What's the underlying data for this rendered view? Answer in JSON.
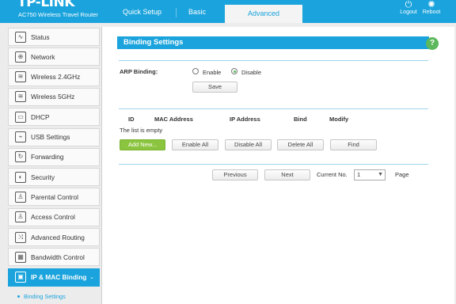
{
  "header": {
    "logo": "TP-LINK",
    "model": "AC750 Wireless Travel Router",
    "tabs": [
      {
        "label": "Quick Setup"
      },
      {
        "label": "Basic"
      },
      {
        "label": "Advanced"
      }
    ],
    "logout_label": "Logout",
    "reboot_label": "Reboot"
  },
  "sidebar": {
    "items": [
      {
        "label": "Status",
        "icon": "status-icon",
        "glyph": "∿"
      },
      {
        "label": "Network",
        "icon": "network-icon",
        "glyph": "⊕"
      },
      {
        "label": "Wireless 2.4GHz",
        "icon": "wireless-icon",
        "glyph": "≋"
      },
      {
        "label": "Wireless 5GHz",
        "icon": "wireless-icon",
        "glyph": "≋"
      },
      {
        "label": "DHCP",
        "icon": "dhcp-icon",
        "glyph": "▭"
      },
      {
        "label": "USB Settings",
        "icon": "usb-icon",
        "glyph": "⌁"
      },
      {
        "label": "Forwarding",
        "icon": "forwarding-icon",
        "glyph": "↻"
      },
      {
        "label": "Security",
        "icon": "security-icon",
        "glyph": "◐"
      },
      {
        "label": "Parental Control",
        "icon": "parental-control-icon",
        "glyph": "♙"
      },
      {
        "label": "Access Control",
        "icon": "access-control-icon",
        "glyph": "♙"
      },
      {
        "label": "Advanced Routing",
        "icon": "routing-icon",
        "glyph": "⤨"
      },
      {
        "label": "Bandwidth Control",
        "icon": "bandwidth-icon",
        "glyph": "▦"
      },
      {
        "label": "IP & MAC Binding",
        "icon": "binding-icon",
        "glyph": "▣"
      }
    ],
    "sub_item": "Binding Settings"
  },
  "main": {
    "section_title": "Binding Settings",
    "help_label": "?",
    "arp_label": "ARP Binding:",
    "enable_label": "Enable",
    "disable_label": "Disable",
    "arp_selected": "Disable",
    "save_label": "Save",
    "table": {
      "columns": [
        "ID",
        "MAC Address",
        "IP Address",
        "Bind",
        "Modify"
      ],
      "empty_text": "The list is empty"
    },
    "buttons": {
      "add_new": "Add New...",
      "enable_all": "Enable All",
      "disable_all": "Disable All",
      "delete_all": "Delete All",
      "find": "Find"
    },
    "pager": {
      "previous": "Previous",
      "next": "Next",
      "current_label": "Current No.",
      "current_value": "1",
      "page_label": "Page"
    }
  },
  "colors": {
    "accent": "#1aa3dc",
    "add_button": "#8bc53f",
    "help": "#5cb85c"
  }
}
